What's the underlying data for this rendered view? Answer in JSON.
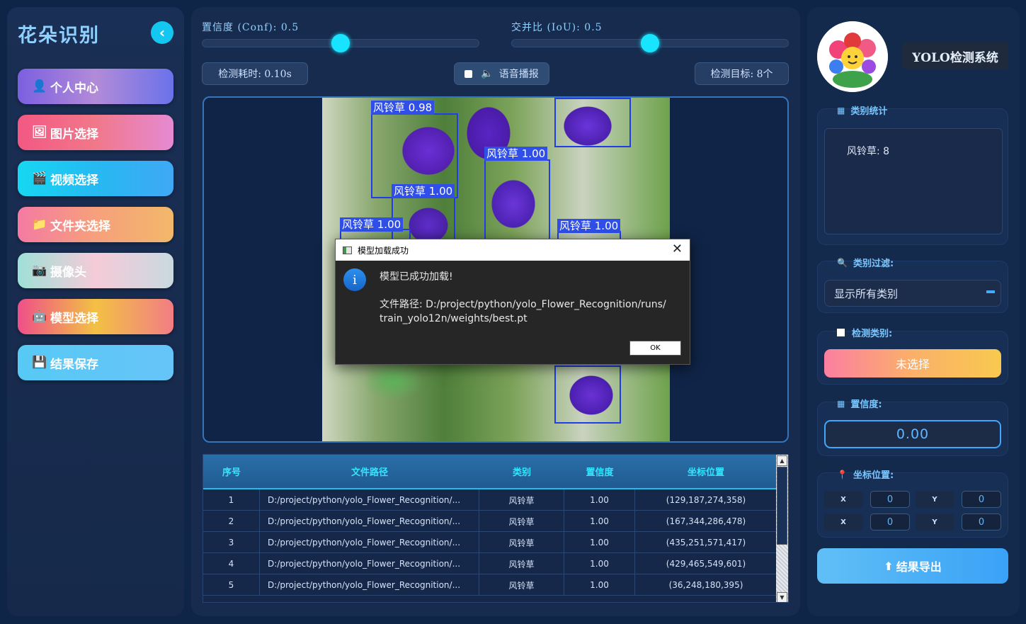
{
  "sidebar": {
    "brand": "花朵识别",
    "collapse_icon": "‹",
    "nav": [
      {
        "label": "个人中心",
        "icon": "👤"
      },
      {
        "label": "图片选择",
        "icon": "🖼"
      },
      {
        "label": "视频选择",
        "icon": "🎬"
      },
      {
        "label": "文件夹选择",
        "icon": "📁"
      },
      {
        "label": "摄像头",
        "icon": "📷"
      },
      {
        "label": "模型选择",
        "icon": "🤖"
      },
      {
        "label": "结果保存",
        "icon": "💾"
      }
    ]
  },
  "controls": {
    "conf_label": "置信度 (Conf): 0.5",
    "conf_value": 0.5,
    "iou_label": "交并比 (IoU): 0.5",
    "iou_value": 0.5,
    "time_label": "检测耗时: 0.10s",
    "voice_label": "语音播报",
    "target_label": "检测目标: 8个"
  },
  "detections": [
    {
      "label": "风铃草 0.98"
    },
    {
      "label": "风铃草 1.00"
    },
    {
      "label": "风铃草 1.00"
    },
    {
      "label": "风铃草 1.00"
    },
    {
      "label": "风铃草 1.00"
    }
  ],
  "table": {
    "headers": [
      "序号",
      "文件路径",
      "类别",
      "置信度",
      "坐标位置"
    ],
    "rows": [
      {
        "idx": "1",
        "path": "D:/project/python/yolo_Flower_Recognition/...",
        "cls": "风铃草",
        "conf": "1.00",
        "coord": "(129,187,274,358)"
      },
      {
        "idx": "2",
        "path": "D:/project/python/yolo_Flower_Recognition/...",
        "cls": "风铃草",
        "conf": "1.00",
        "coord": "(167,344,286,478)"
      },
      {
        "idx": "3",
        "path": "D:/project/python/yolo_Flower_Recognition/...",
        "cls": "风铃草",
        "conf": "1.00",
        "coord": "(435,251,571,417)"
      },
      {
        "idx": "4",
        "path": "D:/project/python/yolo_Flower_Recognition/...",
        "cls": "风铃草",
        "conf": "1.00",
        "coord": "(429,465,549,601)"
      },
      {
        "idx": "5",
        "path": "D:/project/python/yolo_Flower_Recognition/...",
        "cls": "风铃草",
        "conf": "1.00",
        "coord": "(36,248,180,395)"
      }
    ]
  },
  "right": {
    "system_title": "YOLO检测系统",
    "stats_title": "类别统计",
    "stats_text": "风铃草: 8",
    "filter_title": "类别过滤:",
    "filter_value": "显示所有类别",
    "detect_class_title": "检测类别:",
    "unselected_label": "未选择",
    "conf_title": "置信度:",
    "conf_display": "0.00",
    "coord_title": "坐标位置:",
    "coords": [
      {
        "label": "X",
        "value": "0"
      },
      {
        "label": "Y",
        "value": "0"
      },
      {
        "label": "X",
        "value": "0"
      },
      {
        "label": "Y",
        "value": "0"
      }
    ],
    "export_label": "结果导出"
  },
  "dialog": {
    "title": "模型加载成功",
    "close": "✕",
    "info_glyph": "i",
    "message": "模型已成功加载!",
    "path_line1": "文件路径: D:/project/python/yolo_Flower_Recognition/runs/",
    "path_line2": "train_yolo12n/weights/best.pt",
    "ok_label": "OK"
  }
}
